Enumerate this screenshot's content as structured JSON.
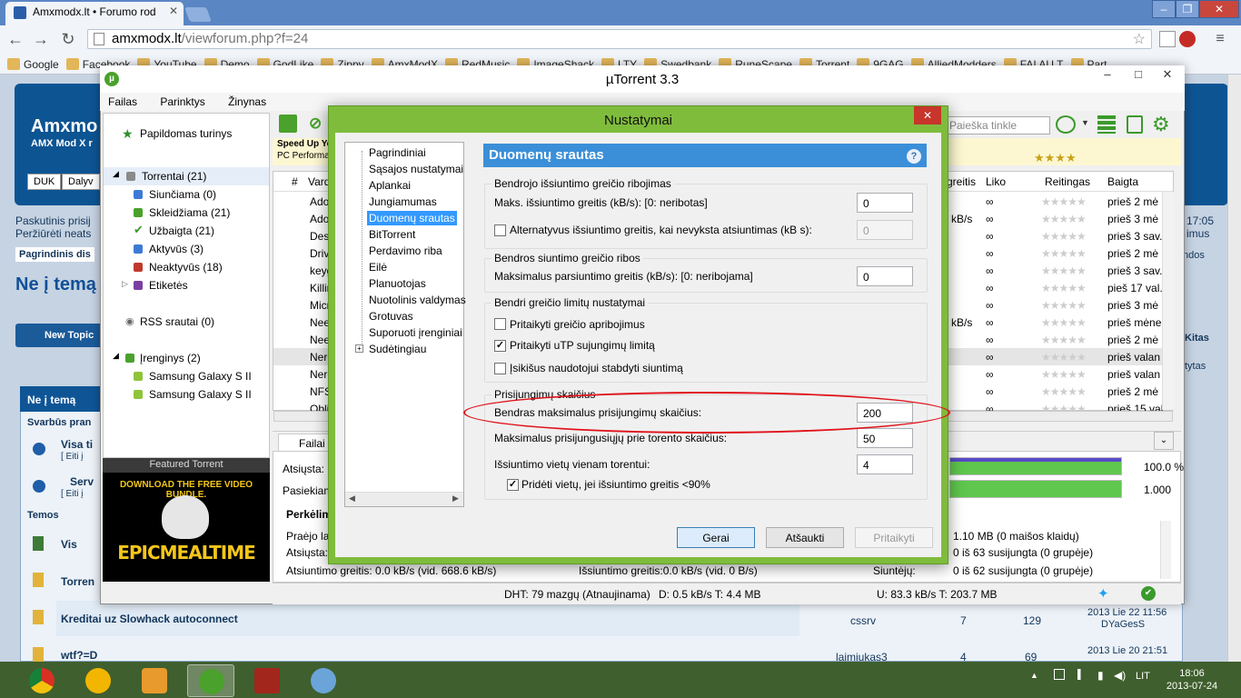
{
  "chrome": {
    "tab_title": "Amxmodx.lt • Forumo rod",
    "url_domain": "amxmodx.lt",
    "url_path": "/viewforum.php?f=24",
    "bookmarks": [
      "Google",
      "Facebook",
      "YouTube",
      "Demo",
      "GodLike",
      "Zippy",
      "AmxModX",
      "RedMusic",
      "ImageShack",
      "LTY",
      "Swedbank",
      "RuneScape",
      "Torrent",
      "9GAG",
      "AlliedModders",
      "FAI AU T",
      "Part"
    ]
  },
  "forum": {
    "title": "Amxmo",
    "subtitle": "AMX Mod X r",
    "nav": [
      "DUK",
      "Dalyv"
    ],
    "last_visit": "Paskutinis prisij",
    "view_unread": "Peržiūrėti neats",
    "breadcrumb": "Pagrindinis dis",
    "heading": "Ne į temą",
    "new_topic": "New Topic",
    "time_right": "17:05",
    "right_text": "imus",
    "right_btn": "ndos",
    "kitas": "Kitas",
    "tytas": "tytas",
    "table_title": "Ne į temą",
    "important": "Svarbūs pran",
    "row1_title": "Visa ti",
    "row1_sub": "[ Eiti į",
    "row2_title": "Serv",
    "row2_sub": "[ Eiti į",
    "temos": "Temos",
    "row3_title": "Vis",
    "row4_title": "Torren",
    "row5": {
      "title": "Kreditai uz Slowhack autoconnect",
      "author": "cssrv",
      "replies": "7",
      "views": "129",
      "date": "2013 Lie 22 11:56",
      "last": "DYaGesS"
    },
    "row6": {
      "title": "wtf?=D",
      "author": "laimiukas3",
      "replies": "4",
      "views": "69",
      "date": "2013 Lie 20 21:51",
      "last": "laimiukas3"
    }
  },
  "utorrent": {
    "title": "µTorrent 3.3",
    "menu": [
      "Failas",
      "Parinktys",
      "Žinynas"
    ],
    "sidebar": {
      "extra": "Papildomas turinys",
      "torrents": "Torrentai (21)",
      "items": [
        "Siunčiama (0)",
        "Skleidžiama (21)",
        "Užbaigta (21)",
        "Aktyvūs (3)",
        "Neaktyvūs (18)",
        "Etiketės"
      ],
      "rss": "RSS srautai (0)",
      "devices": "Įrenginys (2)",
      "device_items": [
        "Samsung Galaxy S II",
        "Samsung Galaxy S II"
      ]
    },
    "featured_title": "Featured Torrent",
    "featured_text": "DOWNLOAD THE FREE VIDEO BUNDLE.",
    "featured_brand": "EPICMEALTIME",
    "search_placeholder": "Paieška tinkle",
    "banner_line1": "Speed Up Yo",
    "banner_line2": "PC Performan",
    "banner_rating": "★★★★",
    "grid_headers": {
      "num": "#",
      "name": "Vard",
      "speed": "greitis",
      "left": "Liko",
      "rating": "Reitingas",
      "done": "Baigta"
    },
    "grid_rows": [
      {
        "name": "Ado",
        "speed": "",
        "left": "∞",
        "done": "prieš 2 mė"
      },
      {
        "name": "Ado",
        "speed": "5 kB/s",
        "left": "∞",
        "done": "prieš 3 mė"
      },
      {
        "name": "Desk",
        "speed": "",
        "left": "∞",
        "done": "prieš 3 sav."
      },
      {
        "name": "Drive",
        "speed": "",
        "left": "∞",
        "done": "prieš 2 mė"
      },
      {
        "name": "keyg",
        "speed": "",
        "left": "∞",
        "done": "prieš 3 sav."
      },
      {
        "name": "Killin",
        "speed": "",
        "left": "∞",
        "done": "pieš 17 val."
      },
      {
        "name": "Micr",
        "speed": "",
        "left": "∞",
        "done": "prieš 3 mė"
      },
      {
        "name": "Nee",
        "speed": "5 kB/s",
        "left": "∞",
        "done": "prieš mėne"
      },
      {
        "name": "Nee",
        "speed": "",
        "left": "∞",
        "done": "prieš 2 mė"
      },
      {
        "name": "Nero",
        "speed": "",
        "left": "∞",
        "done": "prieš valan"
      },
      {
        "name": "Nero",
        "speed": "",
        "left": "∞",
        "done": "prieš valan"
      },
      {
        "name": "NFS",
        "speed": "",
        "left": "∞",
        "done": "prieš 2 mė"
      },
      {
        "name": "Obli",
        "speed": "",
        "left": "∞",
        "done": "prieš 15 val"
      }
    ],
    "detail_tab": "Failai",
    "detail": {
      "downloaded": "Atsiųsta:",
      "availability": "Pasiekiam",
      "pct1": "100.0 %",
      "pct2": "1.000",
      "pct1_value": 1.0,
      "pct2_value": 1.0,
      "transfer": "Perkėlim",
      "passed": "Praėjo lai",
      "downloaded2": "Atsiųsta:",
      "dl_speed": "Atsiuntimo greitis: 0.0 kB/s (vid. 668.6 kB/s)",
      "ul_speed": "Išsiuntimo greitis:0.0 kB/s (vid. 0 B/s)",
      "sent": "Siuntėjų:",
      "wasted": "1.10 MB (0 maišos klaidų)",
      "seeds": "0 iš 63 susijungta (0 grupėje)",
      "peers": "0 iš 62 susijungta (0 grupėje)"
    },
    "status": {
      "dht": "DHT: 79 mazgų (Atnaujinama)",
      "down": "D: 0.5 kB/s T: 4.4 MB",
      "up": "U: 83.3 kB/s T: 203.7 MB"
    }
  },
  "dialog": {
    "title": "Nustatymai",
    "tree": [
      "Pagrindiniai",
      "Sąsajos nustatymai",
      "Aplankai",
      "Jungiamumas",
      "Duomenų srautas",
      "BitTorrent",
      "Perdavimo riba",
      "Eilė",
      "Planuotojas",
      "Nuotolinis valdymas",
      "Grotuvas",
      "Suporuoti įrenginiai",
      "Sudėtingiau"
    ],
    "selected_index": 4,
    "pane_title": "Duomenų srautas",
    "group1": {
      "title": "Bendrojo išsiuntimo greičio ribojimas",
      "max_label": "Maks. išsiuntimo greitis (kB/s): [0: neribotas]",
      "max_value": "0",
      "alt_label": "Alternatyvus išsiuntimo greitis, kai nevyksta atsiuntimas (kB s):",
      "alt_value": "0",
      "alt_checked": false
    },
    "group2": {
      "title": "Bendros siuntimo greičio ribos",
      "max_label": "Maksimalus parsiuntimo greitis (kB/s): [0: neribojama]",
      "max_value": "0"
    },
    "group3": {
      "title": "Bendri greičio limitų nustatymai",
      "opts": [
        {
          "label": "Pritaikyti greičio apribojimus",
          "checked": false
        },
        {
          "label": "Pritaikyti uTP sujungimų limitą",
          "checked": true
        },
        {
          "label": "Įsikišus naudotojui stabdyti siuntimą",
          "checked": false
        }
      ]
    },
    "group4": {
      "title": "Prisijungimų skaičius",
      "global_label": "Bendras maksimalus prisijungimų skaičius:",
      "global_value": "200",
      "per_torrent_label": "Maksimalus prisijungusiųjų prie torento skaičius:",
      "per_torrent_value": "50",
      "slots_label": "Išsiuntimo vietų vienam torentui:",
      "slots_value": "4",
      "extra_label": "Pridėti vietų, jei išsiuntimo greitis <90%",
      "extra_checked": true
    },
    "buttons": {
      "ok": "Gerai",
      "cancel": "Atšaukti",
      "apply": "Pritaikyti"
    }
  },
  "taskbar": {
    "lang": "LIT",
    "time": "18:06",
    "date": "2013-07-24"
  }
}
